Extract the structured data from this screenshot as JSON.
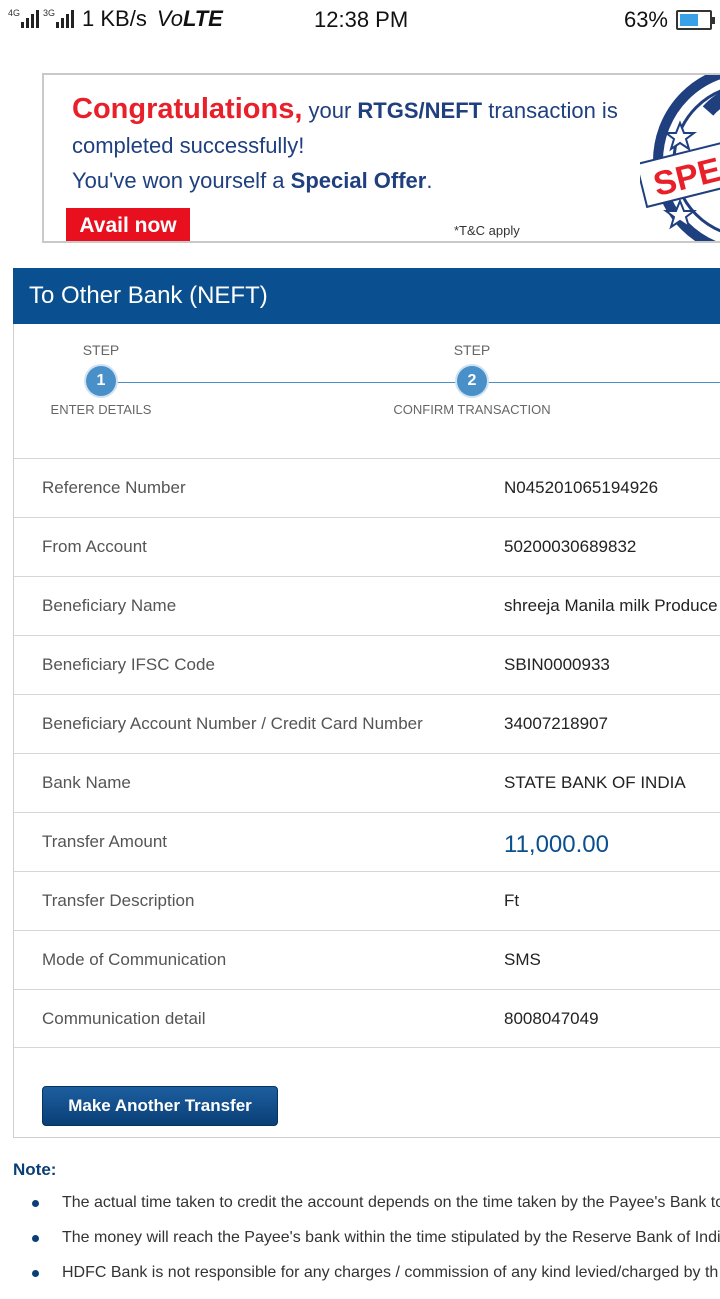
{
  "status_bar": {
    "net1": "4G",
    "net2": "3G",
    "speed": "1 KB/s",
    "volte_prefix": "Vo",
    "volte_suffix": "LTE",
    "time": "12:38 PM",
    "battery": "63%",
    "battery_level": 0.63
  },
  "promo": {
    "congrats": "Congratulations,",
    "line1_a": " your ",
    "line1_bold": "RTGS/NEFT",
    "line1_b": " transaction is",
    "line2": "completed successfully!",
    "line3_a": "You've won yourself a ",
    "line3_bold": "Special Offer",
    "line3_b": ".",
    "avail_button": "Avail now",
    "tnc": "*T&C apply",
    "seal_text": "SPEC"
  },
  "panel": {
    "title": "To Other Bank (NEFT)"
  },
  "steps": [
    {
      "caption": "STEP",
      "number": "1",
      "label": "ENTER DETAILS"
    },
    {
      "caption": "STEP",
      "number": "2",
      "label": "CONFIRM TRANSACTION"
    }
  ],
  "details": [
    {
      "label": "Reference Number",
      "value": "N045201065194926"
    },
    {
      "label": "From Account",
      "value": "50200030689832"
    },
    {
      "label": "Beneficiary Name",
      "value": "shreeja Manila milk Produce"
    },
    {
      "label": "Beneficiary IFSC Code",
      "value": "SBIN0000933"
    },
    {
      "label": "Beneficiary Account Number / Credit Card Number",
      "value": "34007218907"
    },
    {
      "label": "Bank Name",
      "value": "STATE BANK OF INDIA"
    },
    {
      "label": "Transfer Amount",
      "value": "11,000.00"
    },
    {
      "label": "Transfer Description",
      "value": "Ft"
    },
    {
      "label": "Mode of Communication",
      "value": "SMS"
    },
    {
      "label": "Communication detail",
      "value": "8008047049"
    }
  ],
  "actions": {
    "make_another": "Make Another Transfer"
  },
  "note": {
    "title": "Note:",
    "items": [
      "The actual time taken to credit the account depends on the time taken by the Payee's Bank to",
      "The money will reach the Payee's bank within the time stipulated by the Reserve Bank of India",
      "HDFC Bank is not responsible for any charges / commission of any kind levied/charged by th"
    ]
  },
  "colors": {
    "header_blue": "#0a4f8f",
    "step_blue": "#4a90c8",
    "promo_red": "#e8202a",
    "promo_navy": "#1f3f7f"
  }
}
